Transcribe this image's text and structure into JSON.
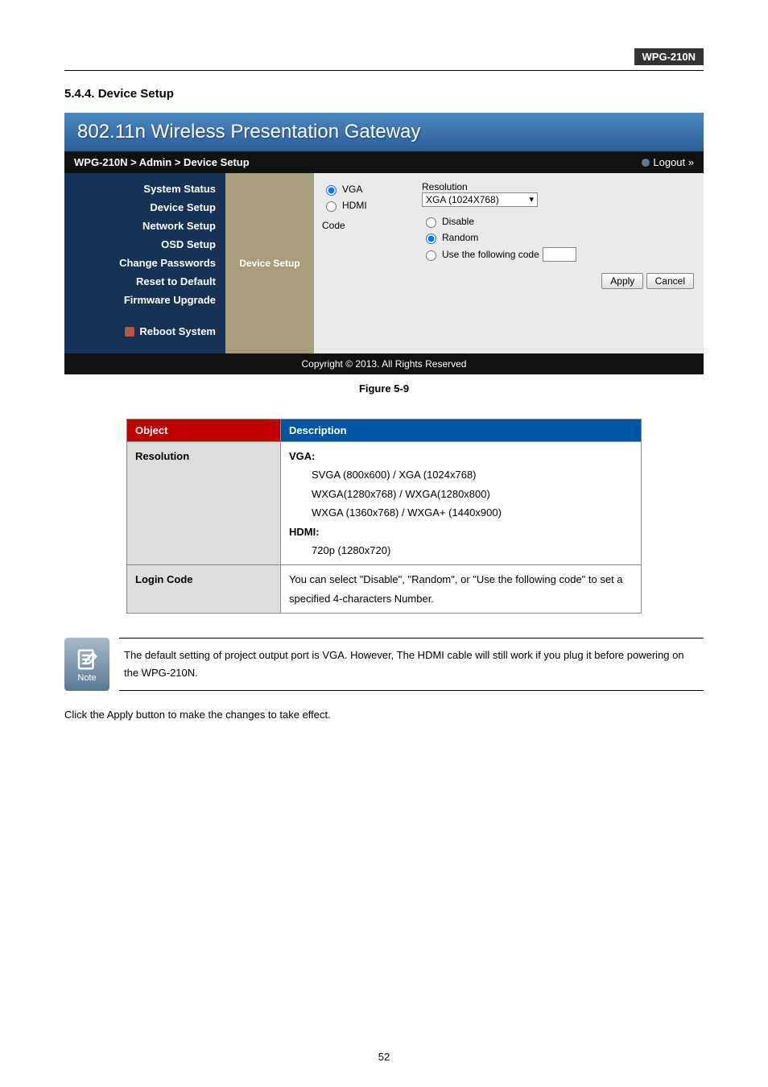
{
  "header": {
    "model": "WPG-210N"
  },
  "section": {
    "number": "5.4.4.",
    "title": "Device Setup"
  },
  "shot": {
    "gateway_title": "802.11n Wireless Presentation Gateway",
    "breadcrumb": "WPG-210N > Admin > Device Setup",
    "logout": "Logout »",
    "sidebar": {
      "items": [
        "System Status",
        "Device Setup",
        "Network Setup",
        "OSD Setup",
        "Change Passwords",
        "Reset to Default",
        "Firmware Upgrade"
      ],
      "reboot": "Reboot System"
    },
    "tab_label": "Device Setup",
    "output_row": {
      "vga": "VGA",
      "hdmi": "HDMI"
    },
    "resolution": {
      "label": "Resolution",
      "value": "XGA (1024X768)"
    },
    "code": {
      "label": "Code",
      "disable": "Disable",
      "random": "Random",
      "use_following": "Use the following code"
    },
    "buttons": {
      "apply": "Apply",
      "cancel": "Cancel"
    },
    "copyright": "Copyright © 2013. All Rights Reserved"
  },
  "figure_caption": "Figure 5-9",
  "desc_table": {
    "headers": {
      "object": "Object",
      "description": "Description"
    },
    "rows": {
      "resolution": {
        "label": "Resolution",
        "vga_heading": "VGA:",
        "vga_lines": [
          "SVGA (800x600) / XGA (1024x768)",
          "WXGA(1280x768) / WXGA(1280x800)",
          "WXGA (1360x768) / WXGA+ (1440x900)"
        ],
        "hdmi_heading": "HDMI:",
        "hdmi_lines": [
          "720p (1280x720)"
        ]
      },
      "login_code": {
        "label": "Login Code",
        "text": "You can select \"Disable\", \"Random\", or \"Use the following code\" to set a specified 4-characters Number."
      }
    }
  },
  "note": {
    "icon_label": "Note",
    "text": "The default setting of project output port is VGA. However, The HDMI cable will still work if you plug it before powering on the WPG-210N."
  },
  "post_note_text": "Click the Apply button to make the changes to take effect.",
  "page_number": "52"
}
